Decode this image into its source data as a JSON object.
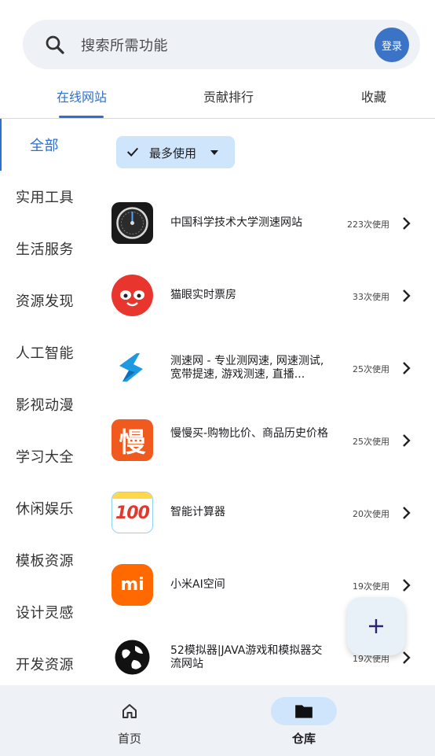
{
  "search": {
    "placeholder": "搜索所需功能",
    "login_label": "登录"
  },
  "tabs": [
    {
      "label": "在线网站",
      "active": true
    },
    {
      "label": "贡献排行",
      "active": false
    },
    {
      "label": "收藏",
      "active": false
    }
  ],
  "sidebar": {
    "items": [
      {
        "label": "全部",
        "active": true
      },
      {
        "label": "实用工具"
      },
      {
        "label": "生活服务"
      },
      {
        "label": "资源发现"
      },
      {
        "label": "人工智能"
      },
      {
        "label": "影视动漫"
      },
      {
        "label": "学习大全"
      },
      {
        "label": "休闲娱乐"
      },
      {
        "label": "模板资源"
      },
      {
        "label": "设计灵感"
      },
      {
        "label": "开发资源"
      }
    ]
  },
  "filter": {
    "label": "最多使用"
  },
  "list": [
    {
      "title": "中国科学技术大学测速网站",
      "count": "223次使用",
      "icon": "speedometer-icon"
    },
    {
      "title": "猫眼实时票房",
      "count": "33次使用",
      "icon": "maoyan-cat-icon"
    },
    {
      "title": "测速网 - 专业测网速, 网速测试, 宽带提速, 游戏测速, 直播...",
      "count": "25次使用",
      "icon": "speedtest-s-icon"
    },
    {
      "title": "慢慢买-购物比价、商品历史价格",
      "count": "25次使用",
      "icon": "manmanmai-icon"
    },
    {
      "title": "智能计算器",
      "count": "20次使用",
      "icon": "calculator-100-icon"
    },
    {
      "title": "小米AI空间",
      "count": "19次使用",
      "icon": "xiaomi-icon"
    },
    {
      "title": "52模拟器|JAVA游戏和模拟器交流网站",
      "count": "19次使用",
      "icon": "globe-icon"
    }
  ],
  "icon_text": {
    "manmanmai": "慢",
    "calculator": "100",
    "xiaomi": "mi"
  },
  "bottom_nav": [
    {
      "label": "首页",
      "icon": "home-icon",
      "active": false
    },
    {
      "label": "仓库",
      "icon": "folder-icon",
      "active": true
    }
  ],
  "colors": {
    "accent": "#2f6fcf",
    "chip_bg": "#cfe5fb",
    "surface": "#eef1f6"
  }
}
